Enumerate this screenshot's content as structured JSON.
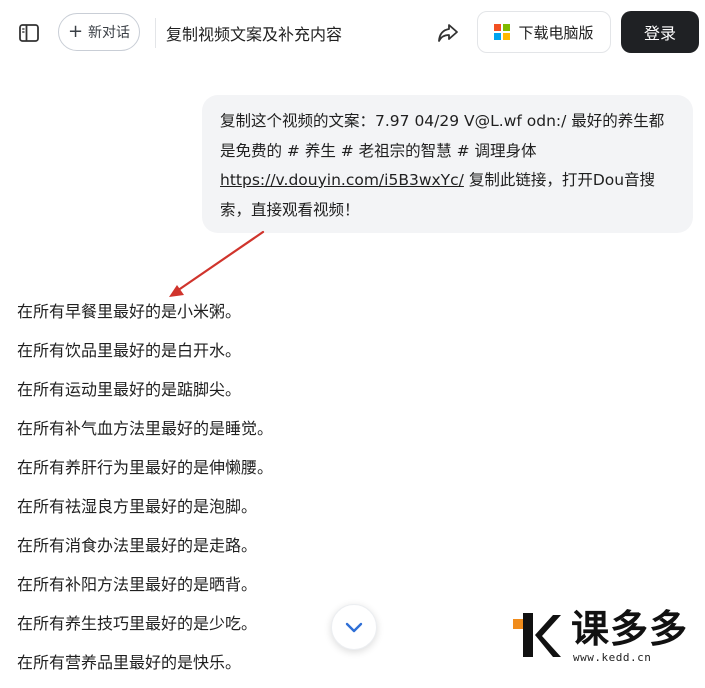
{
  "header": {
    "new_chat_label": "新对话",
    "title": "复制视频文案及补充内容",
    "download_label": "下载电脑版",
    "login_label": "登录"
  },
  "user_message": {
    "line1": "复制这个视频的文案：7.97 04/29 V@L.wf odn:/ 最好的养生都",
    "line2": "是免费的 # 养生 # 老祖宗的智慧 # 调理身体",
    "link": "https://v.douyin.com/i5B3wxYc/",
    "line3_rest": " 复制此链接，打开Dou音搜",
    "line4": "索，直接观看视频！"
  },
  "answer_lines": [
    "在所有早餐里最好的是小米粥。",
    "在所有饮品里最好的是白开水。",
    "在所有运动里最好的是踮脚尖。",
    "在所有补气血方法里最好的是睡觉。",
    "在所有养肝行为里最好的是伸懒腰。",
    "在所有祛湿良方里最好的是泡脚。",
    "在所有消食办法里最好的是走路。",
    "在所有补阳方法里最好的是晒背。",
    "在所有养生技巧里最好的是少吃。",
    "在所有营养品里最好的是快乐。"
  ],
  "watermark": {
    "brand_text": "课多多",
    "url": "www.kedd.cn"
  },
  "icons": {
    "sidebar": "sidebar-toggle-icon",
    "share": "share-icon",
    "windows": "windows-logo-icon",
    "scroll": "chevron-down-icon"
  },
  "colors": {
    "login_bg": "#1f2124",
    "bubble_bg": "#f3f4f6",
    "arrow": "#d0342c",
    "watermark_orange": "#f08c1c",
    "ms_red": "#f25022",
    "ms_green": "#7fba00",
    "ms_blue": "#00a4ef",
    "ms_yellow": "#ffb900"
  }
}
